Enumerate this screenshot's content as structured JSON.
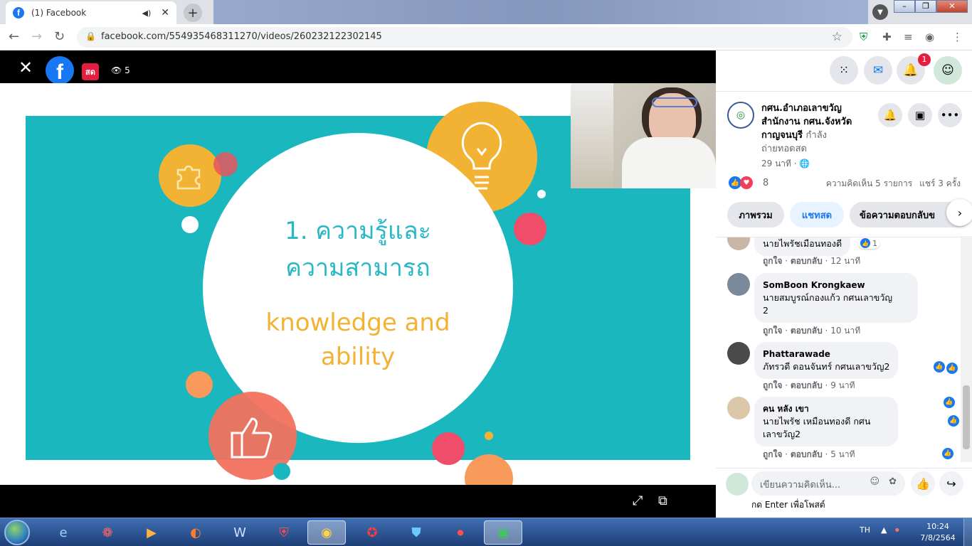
{
  "browser": {
    "tab_title": "(1) Facebook",
    "tab_favicon": "f",
    "url": "facebook.com/554935468311270/videos/260232122302145"
  },
  "video": {
    "live_label": "สด",
    "viewer_count": "5",
    "slide": {
      "line1": "1. ความรู้และ",
      "line2": "ความสามารถ",
      "line3": "knowledge and",
      "line4": "ability"
    },
    "colors": {
      "teal": "#1bb7bf",
      "yellow": "#f2b233",
      "pink": "#f04d6a",
      "orange": "#f79a5b",
      "coral": "#f2715e"
    }
  },
  "header": {
    "notification_count": "1"
  },
  "page": {
    "name_line1": "กศน.อำเภอเลาขวัญ",
    "name_line2": "สำนักงาน กศน.จังหวัด",
    "name_line3": "กาญจนบุรี",
    "status_suffix": "กำลัง",
    "status_line2": "ถ่ายทอดสด",
    "time": "29 นาที ·",
    "reaction_count": "8",
    "comments_count": "ความคิดเห็น 5 รายการ",
    "shares_count": "แชร์ 3 ครั้ง"
  },
  "tabs": [
    {
      "label": "ภาพรวม"
    },
    {
      "label": "แชทสด"
    },
    {
      "label": "ข้อความตอบกลับข"
    }
  ],
  "comments": [
    {
      "name": "",
      "text": "นายไพรัชเมือนทองดี",
      "like_count": "1",
      "like": "ถูกใจ",
      "reply": "ตอบกลับ",
      "time": "12 นาที"
    },
    {
      "name": "SomBoon Krongkaew",
      "text1": "นายสมบูรณ์กองแก้ว กศนเลาขวัญ",
      "text2": "2",
      "like": "ถูกใจ",
      "reply": "ตอบกลับ",
      "time": "10 นาที"
    },
    {
      "name": "Phattarawade",
      "text": "ภัทรวดี ดอนจันทร์ กศนเลาขวัญ2",
      "like": "ถูกใจ",
      "reply": "ตอบกลับ",
      "time": "9 นาที"
    },
    {
      "name": "คน หลัง เขา",
      "text1": "นายไพรัช เหมือนทองดี กศน",
      "text2": "เลาขวัญ2",
      "like": "ถูกใจ",
      "reply": "ตอบกลับ",
      "time": "5 นาที"
    }
  ],
  "composer": {
    "placeholder": "เขียนความคิดเห็น...",
    "hint": "กด Enter เพื่อโพสต์"
  },
  "taskbar": {
    "lang": "TH",
    "time": "10:24",
    "date": "7/8/2564"
  }
}
